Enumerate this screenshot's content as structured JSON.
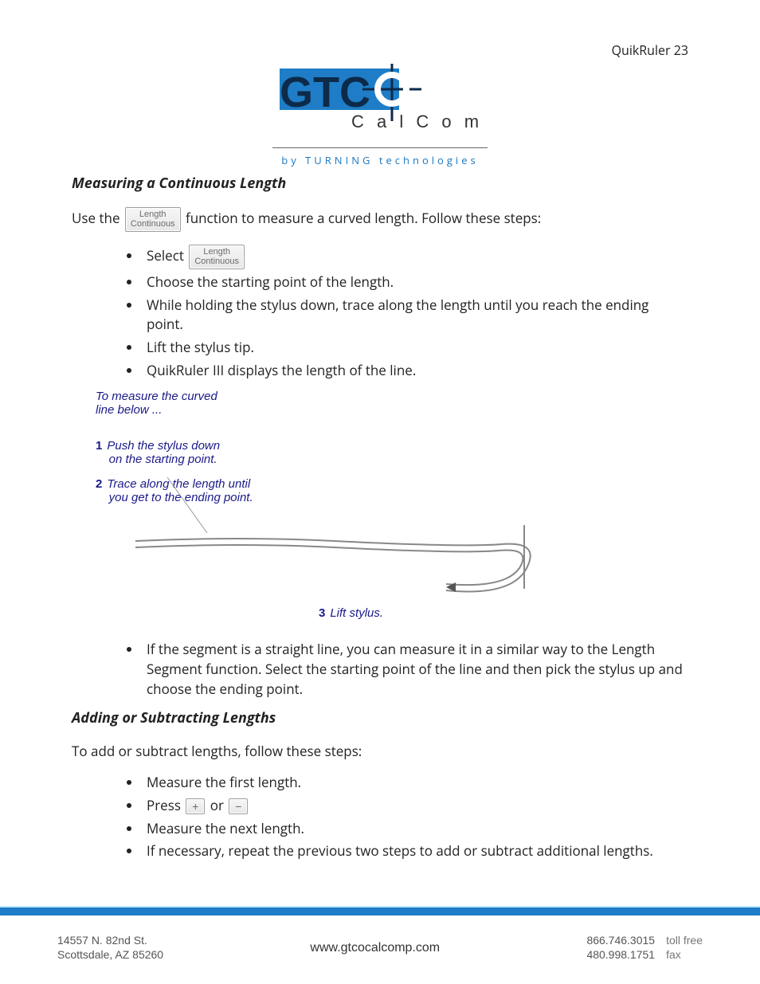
{
  "header": {
    "page_label": "QuikRuler 23"
  },
  "logo": {
    "wordmark_left": "GTC",
    "wordmark_right": "CalComp",
    "byline": "by TURNING technologies"
  },
  "section1": {
    "heading": "Measuring a Continuous Length",
    "intro_before": "Use the ",
    "intro_button_line1": "Length",
    "intro_button_line2": "Continuous",
    "intro_after": " function to measure a curved length.  Follow these steps:",
    "bullets": [
      {
        "before": "Select ",
        "button_line1": "Length",
        "button_line2": "Continuous",
        "after": ""
      },
      {
        "text": "Choose the starting point of the length."
      },
      {
        "text": "While holding the stylus down, trace along the length until you reach the ending point."
      },
      {
        "text": "Lift the stylus tip."
      },
      {
        "text": "QuikRuler III displays the length of the line."
      }
    ],
    "diagram": {
      "caption_line1": "To measure the curved",
      "caption_line2": "line below ...",
      "step1_num": "1",
      "step1_line1": "Push the stylus down",
      "step1_line2": "on the starting point.",
      "step2_num": "2",
      "step2_line1": "Trace along the length until",
      "step2_line2": "you get to the ending point.",
      "step3_num": "3",
      "step3_text": "Lift stylus."
    },
    "post_bullet": "If the segment is a straight line, you can measure it in a similar way to the Length Segment function.  Select the starting point of the line and then pick the stylus up and choose the ending point."
  },
  "section2": {
    "heading": "Adding or Subtracting Lengths",
    "intro": "To add or subtract lengths, follow these steps:",
    "bullets": [
      {
        "text": "Measure the first length."
      },
      {
        "before": "Press ",
        "between": " or ",
        "plus": "+",
        "minus": "−"
      },
      {
        "text": "Measure the next length."
      },
      {
        "text": "If necessary, repeat the previous two steps to add or subtract additional lengths."
      }
    ]
  },
  "footer": {
    "address_line1": "14557 N. 82nd St.",
    "address_line2": "Scottsdale, AZ 85260",
    "url": "www.gtcocalcomp.com",
    "phone1": "866.746.3015",
    "phone1_label": "toll free",
    "phone2": "480.998.1751",
    "phone2_label": "fax"
  }
}
